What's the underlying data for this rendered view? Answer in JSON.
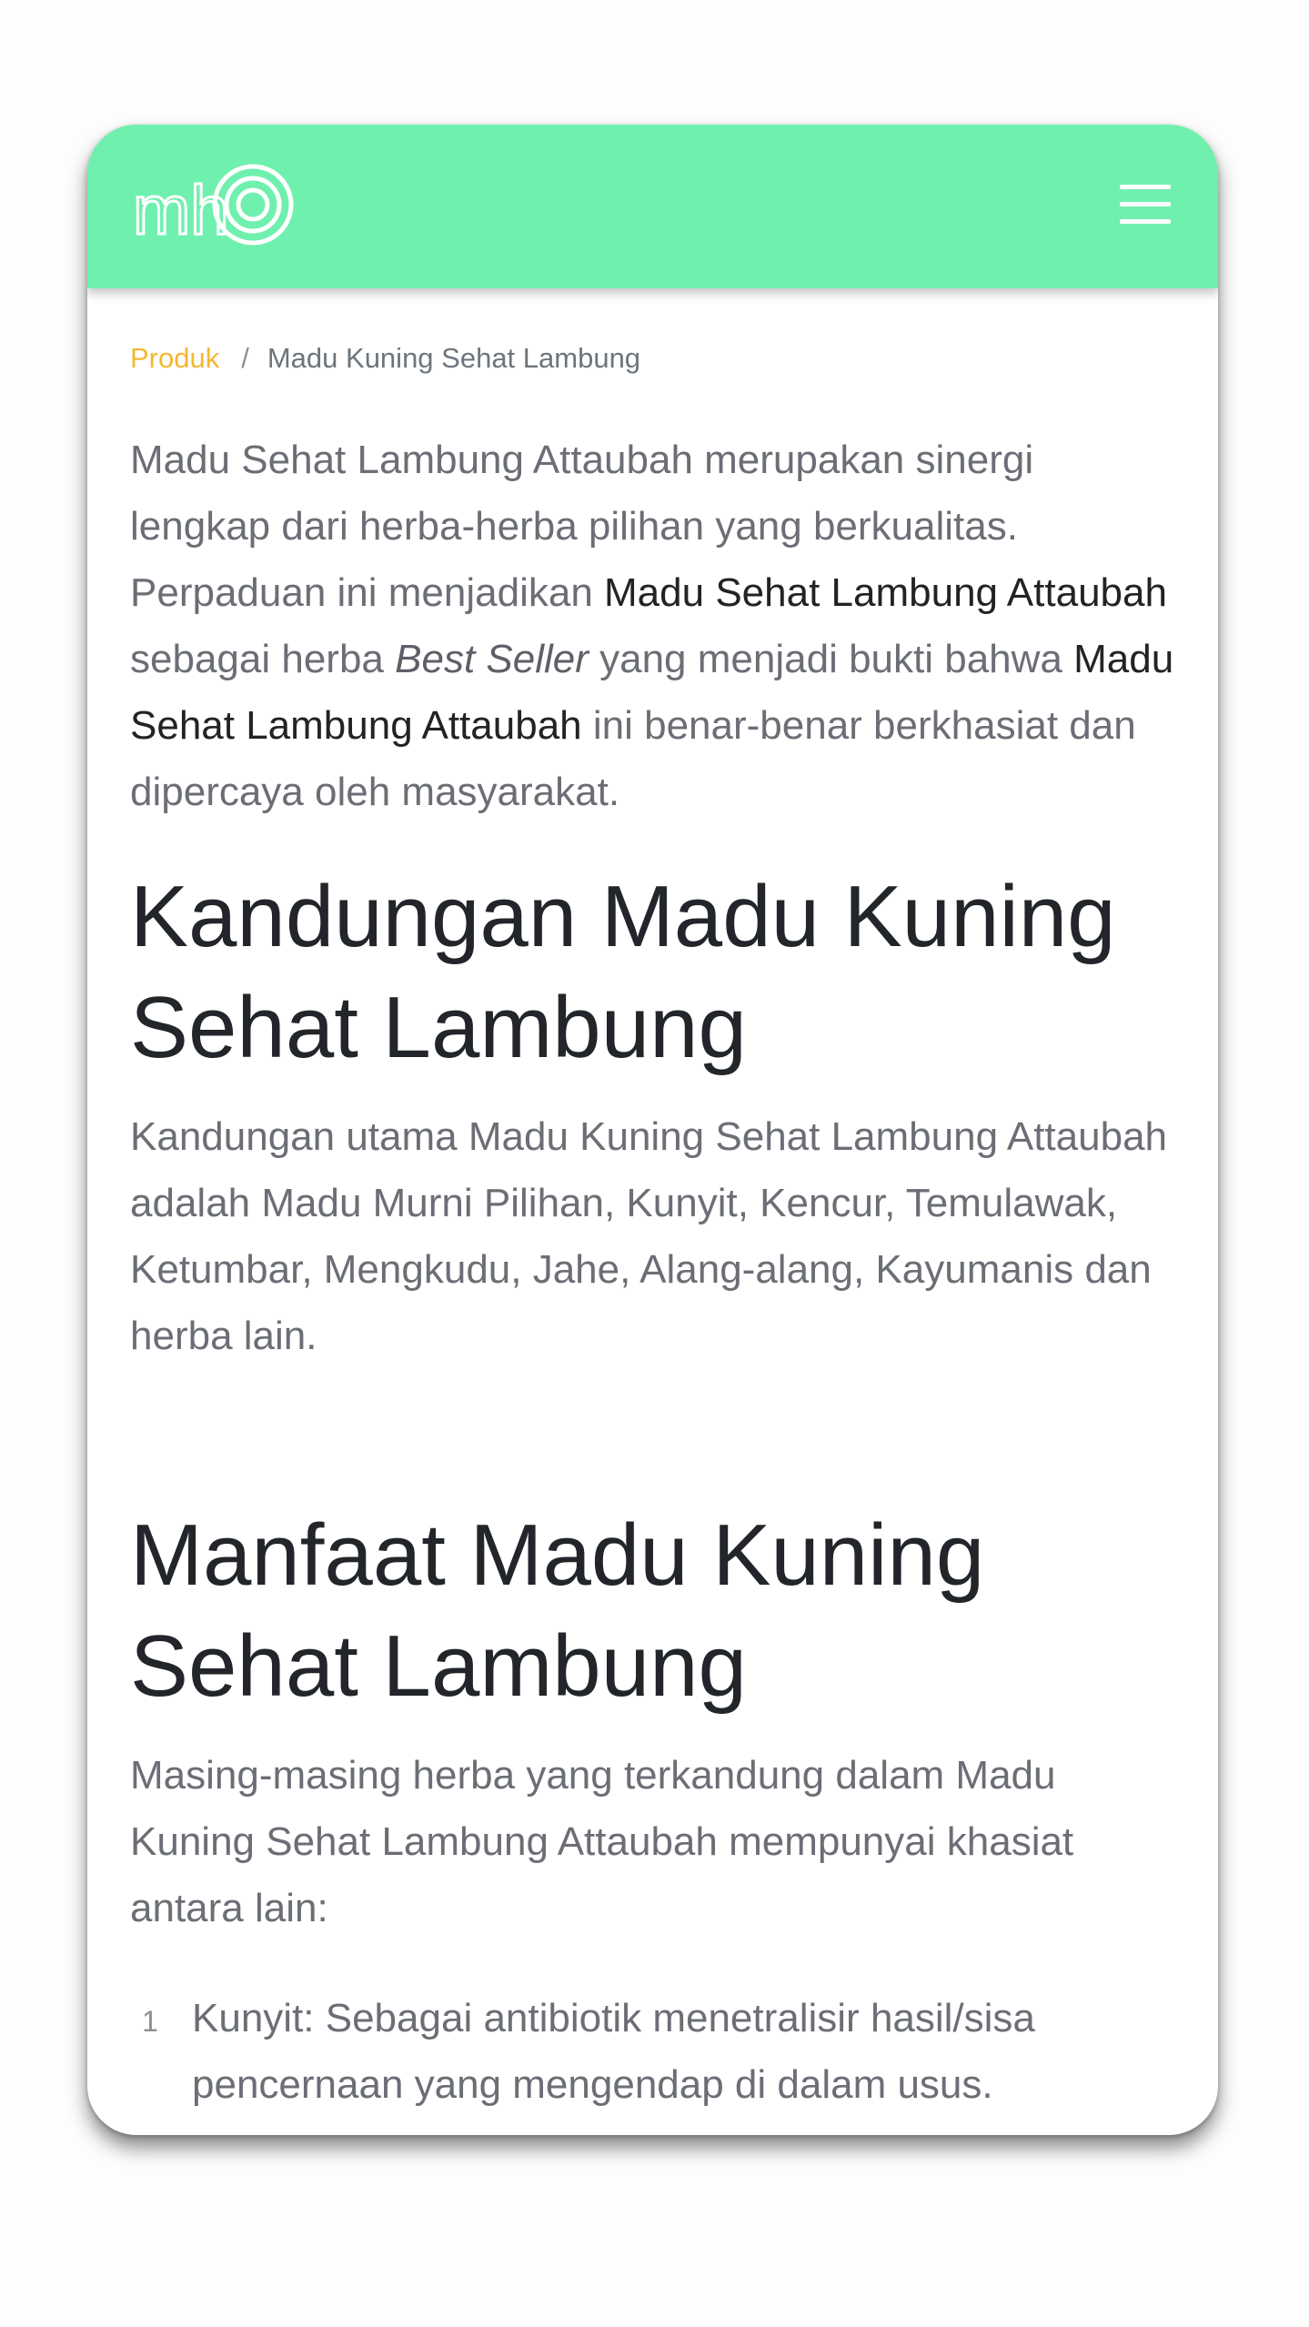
{
  "header": {
    "logo_text": "mh",
    "menu_icon": "hamburger-menu-icon",
    "background_color": "#70f0ae"
  },
  "breadcrumb": {
    "parent": "Produk",
    "separator": "/",
    "current": "Madu Kuning Sehat Lambung"
  },
  "intro": {
    "part1": "Madu Sehat Lambung Attaubah merupakan sinergi lengkap dari herba-herba pilihan yang berkualitas. Perpaduan ini menjadikan ",
    "strong1": "Madu Sehat Lambung Attaubah",
    "part2": " sebagai herba ",
    "emphasis": "Best Seller",
    "part3": " yang menjadi bukti bahwa ",
    "strong2": "Madu Sehat Lambung Attaubah",
    "part4": " ini benar-benar berkhasiat dan dipercaya oleh masyarakat."
  },
  "section_kandungan": {
    "heading": "Kandungan Madu Kuning Sehat Lambung",
    "text": "Kandungan utama Madu Kuning Sehat Lambung Attaubah adalah Madu Murni Pilihan, Kunyit, Kencur, Temulawak, Ketumbar, Mengkudu, Jahe, Alang-alang, Kayumanis dan herba lain."
  },
  "section_manfaat": {
    "heading": "Manfaat Madu Kuning Sehat Lambung",
    "text": "Masing-masing herba yang terkandung dalam Madu Kuning Sehat Lambung Attaubah mempunyai khasiat antara lain:",
    "items": [
      {
        "number": "1",
        "text": "Kunyit: Sebagai antibiotik menetralisir hasil/sisa pencernaan yang mengendap di dalam usus."
      }
    ]
  }
}
